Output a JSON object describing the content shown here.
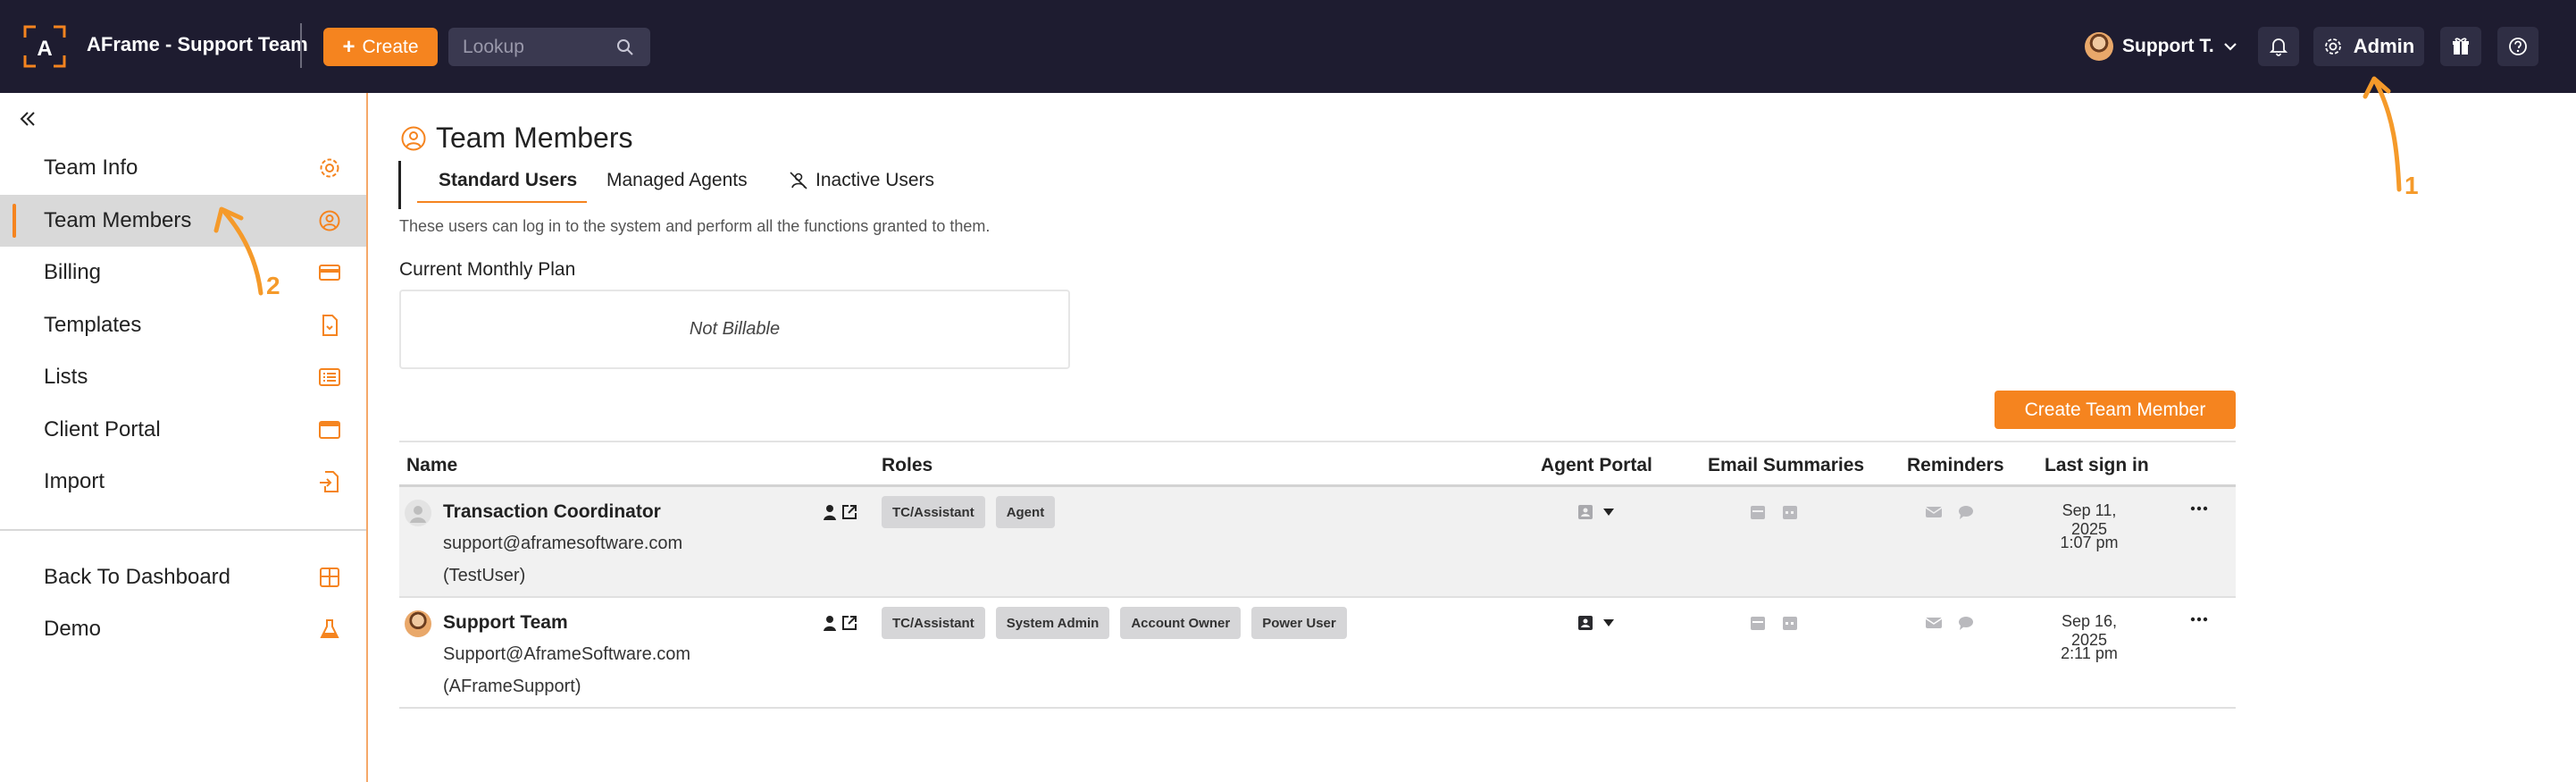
{
  "topbar": {
    "app_title": "AFrame - Support Team",
    "create_label": "Create",
    "lookup_placeholder": "Lookup",
    "user_name": "Support T.",
    "admin_label": "Admin"
  },
  "sidebar": {
    "items": [
      {
        "label": "Team Info",
        "icon": "gear-icon"
      },
      {
        "label": "Team Members",
        "icon": "user-circle-icon",
        "active": true
      },
      {
        "label": "Billing",
        "icon": "credit-card-icon"
      },
      {
        "label": "Templates",
        "icon": "file-icon"
      },
      {
        "label": "Lists",
        "icon": "list-icon"
      },
      {
        "label": "Client Portal",
        "icon": "browser-window-icon"
      },
      {
        "label": "Import",
        "icon": "file-import-icon"
      }
    ],
    "bottom_items": [
      {
        "label": "Back To Dashboard",
        "icon": "dashboard-grid-icon"
      },
      {
        "label": "Demo",
        "icon": "flask-icon"
      }
    ]
  },
  "main": {
    "title": "Team Members",
    "tabs": [
      {
        "label": "Standard Users",
        "active": true
      },
      {
        "label": "Managed Agents"
      },
      {
        "label": "Inactive Users"
      }
    ],
    "description": "These users can log in to the system and perform all the functions granted to them.",
    "plan_label": "Current Monthly Plan",
    "plan_value": "Not Billable",
    "create_member_label": "Create Team Member",
    "columns": [
      "Name",
      "Roles",
      "Agent Portal",
      "Email Summaries",
      "Reminders",
      "Last sign in"
    ],
    "rows": [
      {
        "name": "Transaction Coordinator",
        "email": "support@aframesoftware.com",
        "username": "(TestUser)",
        "roles": [
          "TC/Assistant",
          "Agent"
        ],
        "last_sign_date": "Sep 11, 2025",
        "last_sign_time": "1:07 pm"
      },
      {
        "name": "Support Team",
        "email": "Support@AframeSoftware.com",
        "username": "(AFrameSupport)",
        "roles": [
          "TC/Assistant",
          "System Admin",
          "Account Owner",
          "Power User"
        ],
        "last_sign_date": "Sep 16, 2025",
        "last_sign_time": "2:11 pm"
      }
    ]
  },
  "annotations": {
    "one": "1",
    "two": "2"
  },
  "colors": {
    "accent": "#f5841f",
    "topbar": "#1e1c30",
    "annotation": "#f59a2a"
  }
}
